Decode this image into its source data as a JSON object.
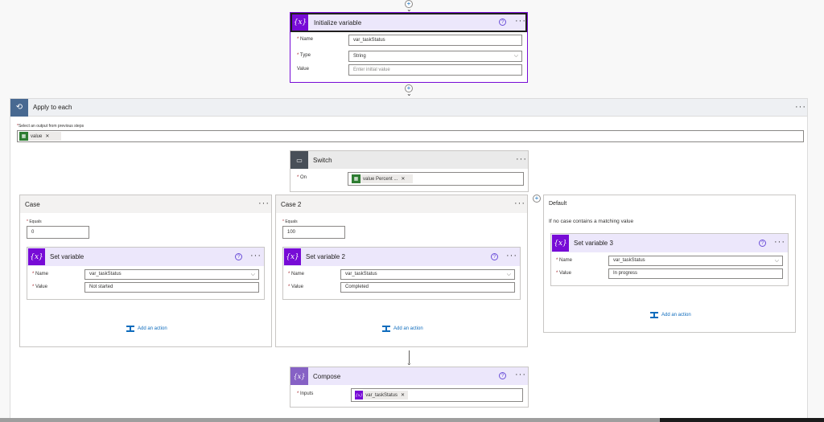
{
  "init_var": {
    "title": "Initialize variable",
    "icon": "{x}",
    "help": "?",
    "more": "···",
    "name_label": "Name",
    "name_value": "var_taskStatus",
    "type_label": "Type",
    "type_value": "String",
    "value_label": "Value",
    "value_placeholder": "Enter initial value"
  },
  "apply_each": {
    "title": "Apply to each",
    "more": "···",
    "select_label": "Select an output from previous steps",
    "token": "value"
  },
  "switch": {
    "title": "Switch",
    "more": "···",
    "on_label": "On",
    "token": "value Percent ..."
  },
  "case1": {
    "title": "Case",
    "more": "···",
    "equals_label": "Equals",
    "equals_value": "0",
    "action": {
      "title": "Set variable",
      "icon": "{x}",
      "help": "?",
      "more": "···",
      "name_label": "Name",
      "name_value": "var_taskStatus",
      "value_label": "Value",
      "value_value": "Not started"
    },
    "add_action": "Add an action"
  },
  "case2": {
    "title": "Case 2",
    "more": "···",
    "equals_label": "Equals",
    "equals_value": "100",
    "action": {
      "title": "Set variable 2",
      "icon": "{x}",
      "help": "?",
      "more": "···",
      "name_label": "Name",
      "name_value": "var_taskStatus",
      "value_label": "Value",
      "value_value": "Completed"
    },
    "add_action": "Add an action"
  },
  "default_case": {
    "title": "Default",
    "description": "If no case contains a matching value",
    "action": {
      "title": "Set variable 3",
      "icon": "{x}",
      "help": "?",
      "more": "···",
      "name_label": "Name",
      "name_value": "var_taskStatus",
      "value_label": "Value",
      "value_value": "In progress"
    },
    "add_action": "Add an action"
  },
  "compose": {
    "title": "Compose",
    "icon": "{x}",
    "help": "?",
    "more": "···",
    "inputs_label": "Inputs",
    "token": "var_taskStatus"
  },
  "colors": {
    "variable_purple": "#770bd6",
    "header_lavender": "#ece7fb",
    "loop_blue": "#486991",
    "switch_dark": "#484f58",
    "token_green": "#2e7d32",
    "link_blue": "#0f6cbd"
  }
}
